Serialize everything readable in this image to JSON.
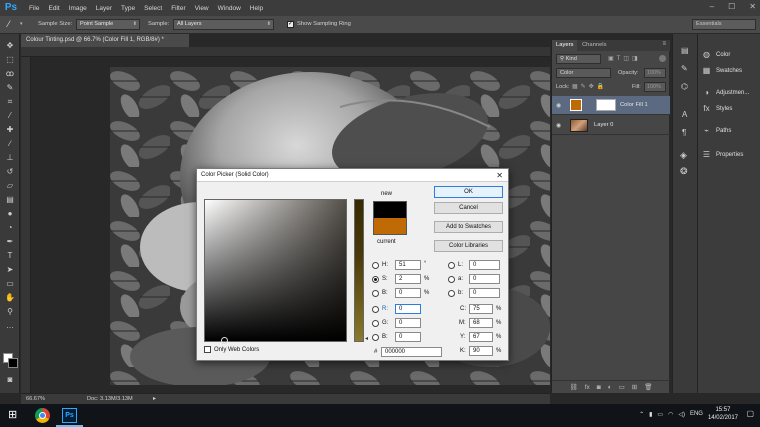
{
  "menu": {
    "logo": "Ps",
    "items": [
      "File",
      "Edit",
      "Image",
      "Layer",
      "Type",
      "Select",
      "Filter",
      "View",
      "Window",
      "Help"
    ]
  },
  "options": {
    "sample_size_label": "Sample Size:",
    "sample_size_value": "Point Sample",
    "sample_label": "Sample:",
    "sample_value": "All Layers",
    "show_ring_label": "Show Sampling Ring",
    "workspace": "Essentials"
  },
  "document": {
    "tab_title": "Colour Tinting.psd @ 66.7% (Color Fill 1, RGB/8#) *",
    "zoom": "66.67%",
    "doc_info": "Doc: 3.13M/3.13M"
  },
  "layers_panel": {
    "tabs": [
      "Layers",
      "Channels"
    ],
    "filter": "Kind",
    "blend_mode": "Color",
    "opacity_label": "Opacity:",
    "opacity_value": "100%",
    "lock_label": "Lock:",
    "fill_label": "Fill:",
    "fill_value": "100%",
    "layers": [
      {
        "name": "Color Fill 1",
        "selected": true
      },
      {
        "name": "Layer 0",
        "selected": false
      }
    ]
  },
  "mini_panels": [
    "Color",
    "Swatches",
    "Adjustmen...",
    "Styles",
    "Paths",
    "Properties"
  ],
  "color_picker": {
    "title": "Color Picker (Solid Color)",
    "new_label": "new",
    "current_label": "current",
    "new_color": "#000000",
    "current_color": "#c06a05",
    "buttons": {
      "ok": "OK",
      "cancel": "Cancel",
      "add_to_swatches": "Add to Swatches",
      "color_libraries": "Color Libraries"
    },
    "fields": {
      "H": "51",
      "S": "2",
      "B": "0",
      "R": "0",
      "G": "0",
      "Bl": "0",
      "L": "0",
      "a": "0",
      "b": "0",
      "C": "75",
      "M": "68",
      "Y": "67",
      "K": "90",
      "hex": "000000"
    },
    "labels": {
      "H": "H:",
      "S": "S:",
      "B": "B:",
      "R": "R:",
      "G": "G:",
      "Bl": "B:",
      "L": "L:",
      "a": "a:",
      "b": "b:",
      "C": "C:",
      "M": "M:",
      "Y": "Y:",
      "K": "K:",
      "hex": "#"
    },
    "units": {
      "deg": "°",
      "pct": "%"
    },
    "only_web_colors": "Only Web Colors"
  },
  "taskbar": {
    "language": "ENG",
    "time": "15:57",
    "date": "14/02/2017"
  }
}
